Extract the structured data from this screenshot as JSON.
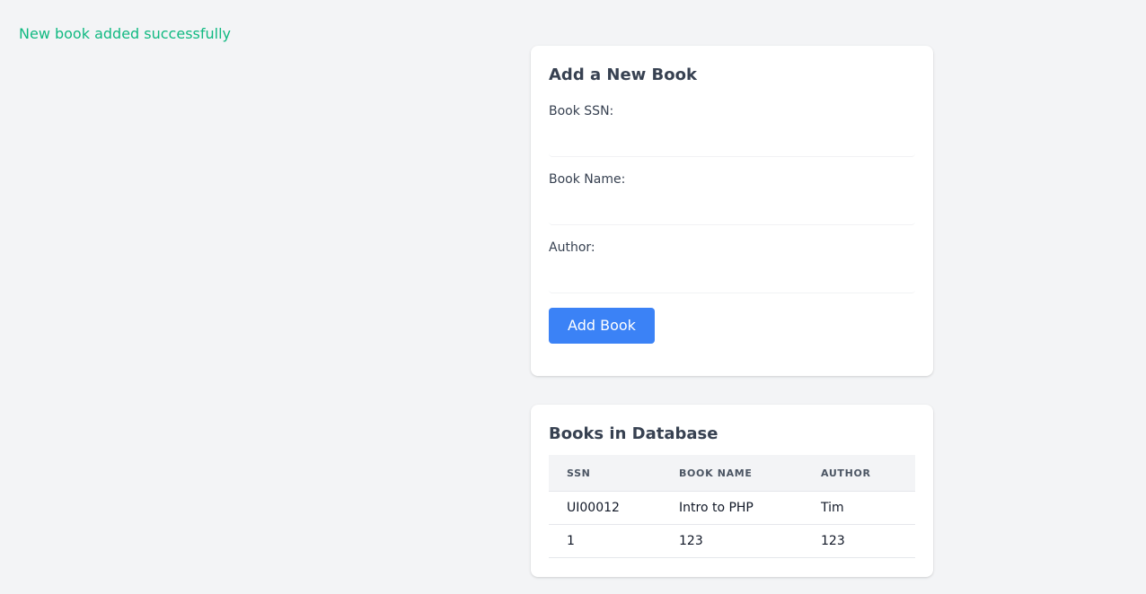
{
  "flash": {
    "message": "New book added successfully"
  },
  "form": {
    "title": "Add a New Book",
    "ssn_label": "Book SSN:",
    "ssn_value": "",
    "name_label": "Book Name:",
    "name_value": "",
    "author_label": "Author:",
    "author_value": "",
    "submit_label": "Add Book"
  },
  "books": {
    "title": "Books in Database",
    "columns": [
      "SSN",
      "BOOK NAME",
      "AUTHOR"
    ],
    "rows": [
      [
        "UI00012",
        "Intro to PHP",
        "Tim"
      ],
      [
        "1",
        "123",
        "123"
      ]
    ]
  },
  "colors": {
    "success": "#10b981",
    "accent": "#3b82f6",
    "background": "#f3f4f6"
  }
}
